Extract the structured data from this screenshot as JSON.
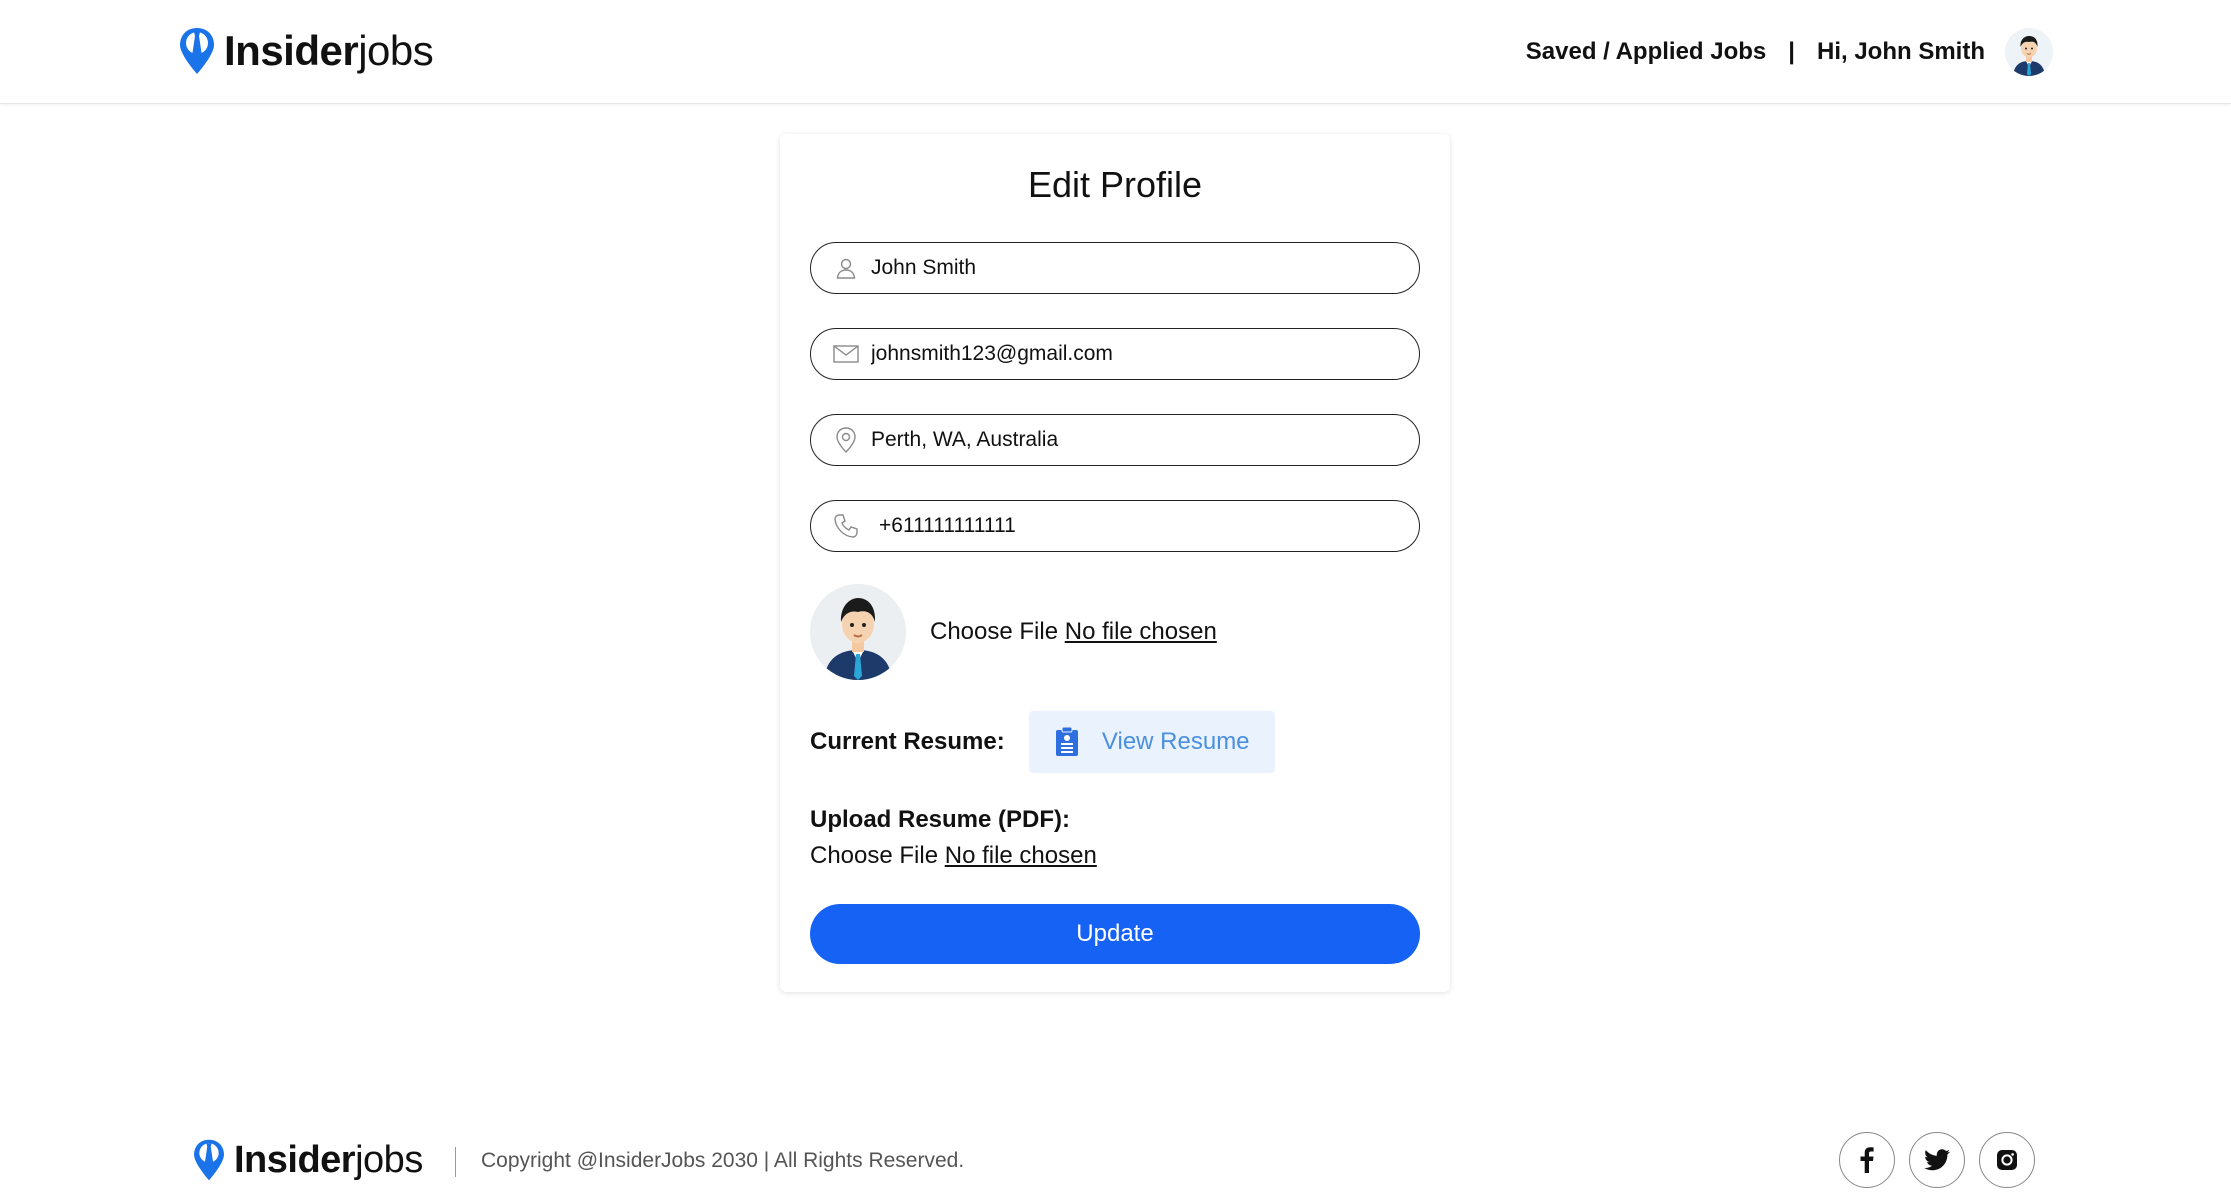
{
  "header": {
    "brand_bold": "Insider",
    "brand_light": "jobs",
    "nav_saved": "Saved / Applied Jobs",
    "nav_sep": "|",
    "greeting": "Hi, John Smith"
  },
  "form": {
    "title": "Edit Profile",
    "name_value": "John Smith",
    "email_value": "johnsmith123@gmail.com",
    "location_value": "Perth, WA, Australia",
    "phone_value": "+611111111111",
    "photo_choose_label": "Choose File",
    "photo_chosen_text": "No file chosen",
    "resume_label": "Current Resume:",
    "view_resume_label": "View Resume",
    "upload_label": "Upload Resume (PDF):",
    "resume_choose_label": "Choose File",
    "resume_chosen_text": "No file chosen",
    "update_label": "Update"
  },
  "footer": {
    "brand_bold": "Insider",
    "brand_light": "jobs",
    "copyright": "Copyright @InsiderJobs 2030 | All Rights Reserved."
  },
  "icons": {
    "brand": "insiderjobs-logo-icon",
    "name": "user-icon",
    "email": "mail-icon",
    "location": "location-pin-icon",
    "phone": "phone-icon",
    "resume": "document-icon",
    "facebook": "facebook-icon",
    "twitter": "twitter-icon",
    "instagram": "instagram-icon"
  },
  "colors": {
    "accent": "#1662f5",
    "brand_blue": "#1a73e8",
    "view_resume_bg": "#eaf3fd",
    "view_resume_text": "#4a8fe0"
  }
}
